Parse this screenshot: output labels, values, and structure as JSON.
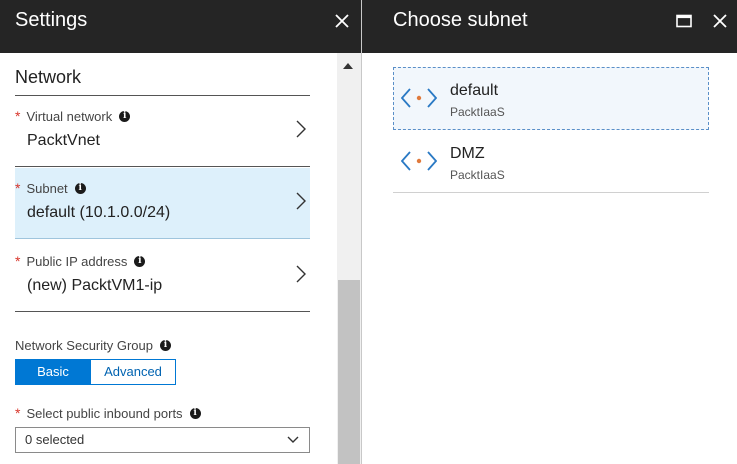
{
  "settings_blade": {
    "title": "Settings",
    "close_icon": "close-icon",
    "section_title": "Network",
    "rows": [
      {
        "label": "Virtual network",
        "required": "*",
        "value": "PacktVnet",
        "selected": false
      },
      {
        "label": "Subnet",
        "required": "*",
        "value": "default (10.1.0.0/24)",
        "selected": true
      },
      {
        "label": "Public IP address",
        "required": "*",
        "value": "(new) PacktVM1-ip",
        "selected": false
      }
    ],
    "nsg": {
      "label": "Network Security Group",
      "options": [
        "Basic",
        "Advanced"
      ],
      "selected": "Basic"
    },
    "ports": {
      "label": "Select public inbound ports",
      "required": "*",
      "value": "0 selected"
    },
    "info_glyph": "i"
  },
  "subnet_blade": {
    "title": "Choose subnet",
    "maximize_icon": "maximize-icon",
    "close_icon": "close-icon",
    "subnets": [
      {
        "name": "default",
        "subtitle": "PacktIaaS",
        "icon": "subnet-icon"
      },
      {
        "name": "DMZ",
        "subtitle": "PacktIaaS",
        "icon": "subnet-icon"
      }
    ]
  },
  "colors": {
    "header_bg": "#252525",
    "accent": "#0078d4",
    "selected_row_bg": "#ddf0fb",
    "required": "#d8352b",
    "subnet_icon_brackets": "#2a79c4",
    "subnet_icon_dot": "#e07a3c"
  }
}
